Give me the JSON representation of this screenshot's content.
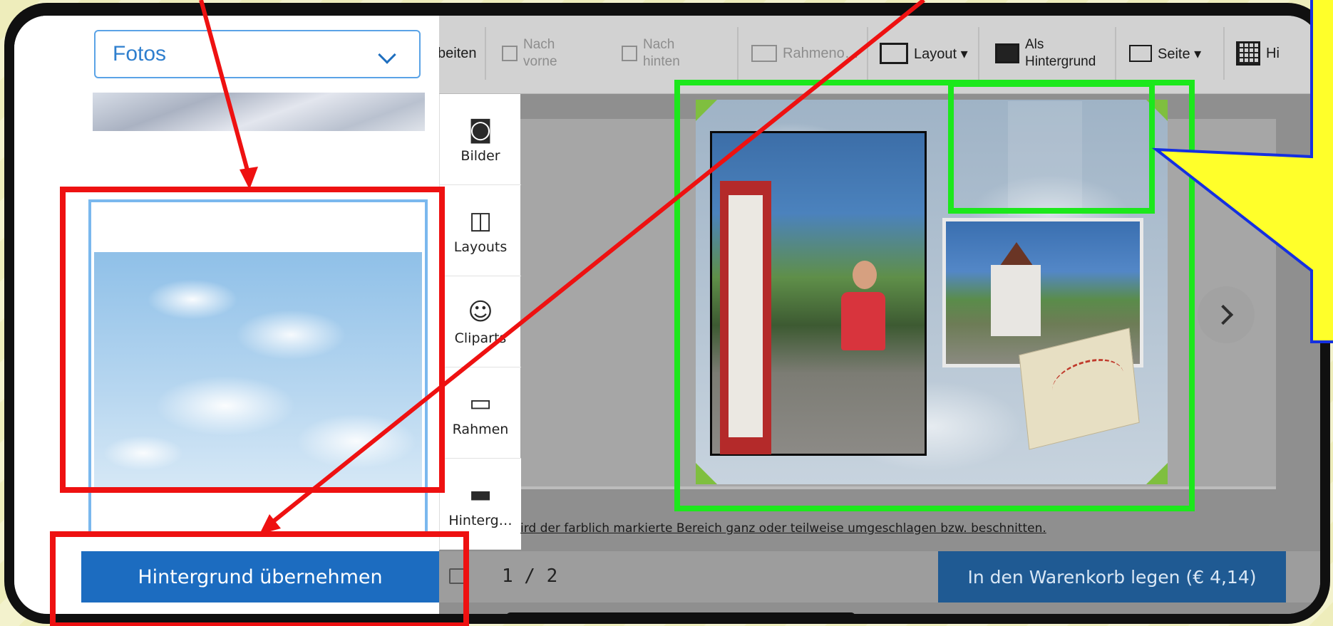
{
  "sidebar": {
    "category_select": {
      "selected": "Fotos"
    },
    "apply_button": "Hintergrund übernehmen"
  },
  "toolbar": {
    "cut_label": "beiten",
    "forward": {
      "line1": "Nach",
      "line2": "vorne"
    },
    "backward": {
      "line1": "Nach",
      "line2": "hinten"
    },
    "frame_label": "Rahmeno…",
    "layout_label": "Layout ▾",
    "background": {
      "line1": "Als",
      "line2": "Hintergrund"
    },
    "page_label": "Seite ▾",
    "help_label": "Hi"
  },
  "tools": [
    {
      "label": "Bilder",
      "icon": "camera-icon"
    },
    {
      "label": "Layouts",
      "icon": "layout-icon"
    },
    {
      "label": "Cliparts",
      "icon": "smiley-icon"
    },
    {
      "label": "Rahmen",
      "icon": "frame-icon"
    },
    {
      "label": "Hinterg…",
      "icon": "background-icon"
    }
  ],
  "hint_text": "ird der farblich markierte Bereich ganz oder teilweise umgeschlagen bzw. beschnitten.",
  "bottom": {
    "page_indicator": "1 / 2",
    "cart_button": "In den Warenkorb legen (€ 4,14)"
  },
  "colors": {
    "annotation_red": "#ee1111",
    "annotation_green": "#1ce81c",
    "annotation_blue": "#1530e0",
    "callout_yellow": "#ffff2a",
    "primary_blue": "#1c6cc0"
  }
}
